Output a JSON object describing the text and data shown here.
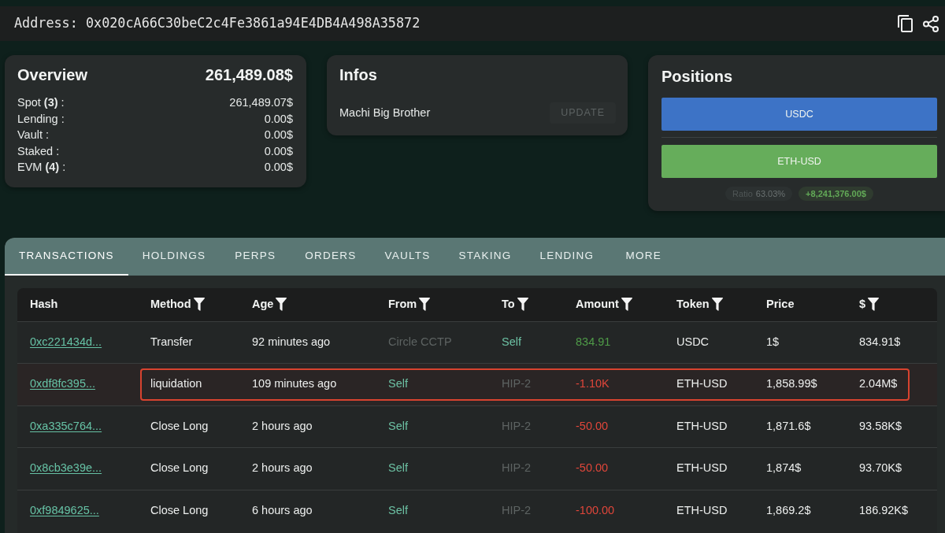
{
  "address_bar": {
    "text": "Address: 0x020cA66C30beC2c4Fe3861a94E4DB4A498A35872"
  },
  "overview": {
    "title": "Overview",
    "total": "261,489.08$",
    "rows": [
      {
        "label": "Spot **(3)** :",
        "value": "261,489.07$"
      },
      {
        "label": "Lending :",
        "value": "0.00$"
      },
      {
        "label": "Vault :",
        "value": "0.00$"
      },
      {
        "label": "Staked :",
        "value": "0.00$"
      },
      {
        "label": "EVM **(4)** :",
        "value": "0.00$"
      }
    ]
  },
  "infos": {
    "title": "Infos",
    "name": "Machi Big Brother",
    "button": {
      "label": "UPDATE",
      "disabled": true
    }
  },
  "positions": {
    "title": "Positions",
    "bars": [
      {
        "label": "USDC",
        "color": "#3d73c6"
      },
      {
        "label": "ETH-USD",
        "color": "#66ad5b"
      }
    ],
    "ratio": {
      "label": "Ratio",
      "value": "63.03%"
    },
    "pnl": {
      "text": "+8,241,376.00$",
      "kind": "positive"
    }
  },
  "tabs": [
    {
      "label": "TRANSACTIONS",
      "selected": true
    },
    {
      "label": "HOLDINGS",
      "selected": false
    },
    {
      "label": "PERPS",
      "selected": false
    },
    {
      "label": "ORDERS",
      "selected": false
    },
    {
      "label": "VAULTS",
      "selected": false
    },
    {
      "label": "STAKING",
      "selected": false
    },
    {
      "label": "LENDING",
      "selected": false
    },
    {
      "label": "MORE",
      "selected": false
    }
  ],
  "transactions": {
    "columns": [
      {
        "label": "Hash",
        "filter": false
      },
      {
        "label": "Method",
        "filter": true
      },
      {
        "label": "Age",
        "filter": true
      },
      {
        "label": "From",
        "filter": true
      },
      {
        "label": "To",
        "filter": true
      },
      {
        "label": "Amount",
        "filter": true
      },
      {
        "label": "Token",
        "filter": true
      },
      {
        "label": "Price",
        "filter": false
      },
      {
        "label": "$",
        "filter": true
      }
    ],
    "rows": [
      {
        "highlighted": false,
        "cells": [
          {
            "text": "0xc221434d...",
            "kind": "link"
          },
          {
            "text": "Transfer",
            "kind": "text"
          },
          {
            "text": "92 minutes ago",
            "kind": "text"
          },
          {
            "text": "Circle CCTP",
            "kind": "address"
          },
          {
            "text": "Self",
            "kind": "own_address"
          },
          {
            "text": "834.91",
            "kind": "positive"
          },
          {
            "text": "USDC",
            "kind": "text"
          },
          {
            "text": "1$",
            "kind": "text"
          },
          {
            "text": "834.91$",
            "kind": "text"
          }
        ]
      },
      {
        "highlighted": true,
        "cells": [
          {
            "text": "0xdf8fc395...",
            "kind": "link"
          },
          {
            "text": "liquidation",
            "kind": "text"
          },
          {
            "text": "109 minutes ago",
            "kind": "text"
          },
          {
            "text": "Self",
            "kind": "own_address"
          },
          {
            "text": "HIP-2",
            "kind": "address"
          },
          {
            "text": "-1.10K",
            "kind": "negative"
          },
          {
            "text": "ETH-USD",
            "kind": "text"
          },
          {
            "text": "1,858.99$",
            "kind": "text"
          },
          {
            "text": "2.04M$",
            "kind": "text"
          }
        ]
      },
      {
        "highlighted": false,
        "cells": [
          {
            "text": "0xa335c764...",
            "kind": "link"
          },
          {
            "text": "Close Long",
            "kind": "text"
          },
          {
            "text": "2 hours ago",
            "kind": "text"
          },
          {
            "text": "Self",
            "kind": "own_address"
          },
          {
            "text": "HIP-2",
            "kind": "address"
          },
          {
            "text": "-50.00",
            "kind": "negative"
          },
          {
            "text": "ETH-USD",
            "kind": "text"
          },
          {
            "text": "1,871.6$",
            "kind": "text"
          },
          {
            "text": "93.58K$",
            "kind": "text"
          }
        ]
      },
      {
        "highlighted": false,
        "cells": [
          {
            "text": "0x8cb3e39e...",
            "kind": "link"
          },
          {
            "text": "Close Long",
            "kind": "text"
          },
          {
            "text": "2 hours ago",
            "kind": "text"
          },
          {
            "text": "Self",
            "kind": "own_address"
          },
          {
            "text": "HIP-2",
            "kind": "address"
          },
          {
            "text": "-50.00",
            "kind": "negative"
          },
          {
            "text": "ETH-USD",
            "kind": "text"
          },
          {
            "text": "1,874$",
            "kind": "text"
          },
          {
            "text": "93.70K$",
            "kind": "text"
          }
        ]
      },
      {
        "highlighted": false,
        "cells": [
          {
            "text": "0xf9849625...",
            "kind": "link"
          },
          {
            "text": "Close Long",
            "kind": "text"
          },
          {
            "text": "6 hours ago",
            "kind": "text"
          },
          {
            "text": "Self",
            "kind": "own_address"
          },
          {
            "text": "HIP-2",
            "kind": "address"
          },
          {
            "text": "-100.00",
            "kind": "negative"
          },
          {
            "text": "ETH-USD",
            "kind": "text"
          },
          {
            "text": "1,869.2$",
            "kind": "text"
          },
          {
            "text": "186.92K$",
            "kind": "text"
          }
        ]
      }
    ]
  }
}
